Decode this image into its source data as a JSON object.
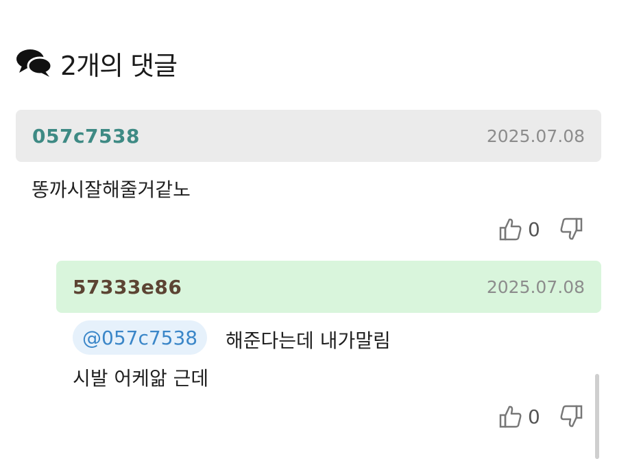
{
  "header": {
    "title": "2개의 댓글",
    "icon": "comments-icon"
  },
  "comments": [
    {
      "author": "057c7538",
      "author_color": "#3e8a84",
      "date": "2025.07.08",
      "text": "똥까시잘해줄거같노",
      "upvotes": "0"
    },
    {
      "author": "57333e86",
      "author_color": "#5c4433",
      "date": "2025.07.08",
      "mention": "@057c7538",
      "text_line1": "해준다는데 내가말림",
      "text_line2": "시발 어케앎 근데",
      "upvotes": "0"
    }
  ],
  "colors": {
    "bar_gray": "#ebebeb",
    "bar_green": "#d9f5dc",
    "mention_bg": "#e6f1fb",
    "mention_text": "#3a86c8"
  }
}
